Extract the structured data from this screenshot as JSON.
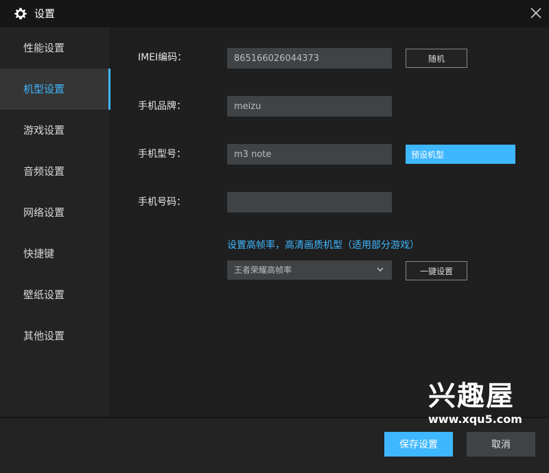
{
  "window": {
    "title": "设置",
    "close_icon": "close-icon",
    "title_icon": "gear-icon"
  },
  "sidebar": {
    "items": [
      {
        "label": "性能设置",
        "active": false
      },
      {
        "label": "机型设置",
        "active": true
      },
      {
        "label": "游戏设置",
        "active": false
      },
      {
        "label": "音频设置",
        "active": false
      },
      {
        "label": "网络设置",
        "active": false
      },
      {
        "label": "快捷键",
        "active": false
      },
      {
        "label": "壁纸设置",
        "active": false
      },
      {
        "label": "其他设置",
        "active": false
      }
    ]
  },
  "form": {
    "imei": {
      "label": "IMEI编码：",
      "value": "865166026044373",
      "button": "随机"
    },
    "brand": {
      "label": "手机品牌：",
      "value": "meizu"
    },
    "model": {
      "label": "手机型号：",
      "value": "m3 note",
      "button": "预设机型"
    },
    "phone": {
      "label": "手机号码：",
      "value": ""
    },
    "frequency": {
      "title": "设置高帧率，高清画质机型（适用部分游戏）",
      "selected": "王者荣耀高帧率",
      "button": "一键设置"
    }
  },
  "footer": {
    "save": "保存设置",
    "cancel": "取消"
  },
  "watermark": {
    "title": "兴趣屋",
    "url": "www.xqu5.com"
  },
  "colors": {
    "accent": "#3fb7ff",
    "titlebar": "#161616",
    "panel": "#1f1f1f",
    "field": "#404346"
  }
}
